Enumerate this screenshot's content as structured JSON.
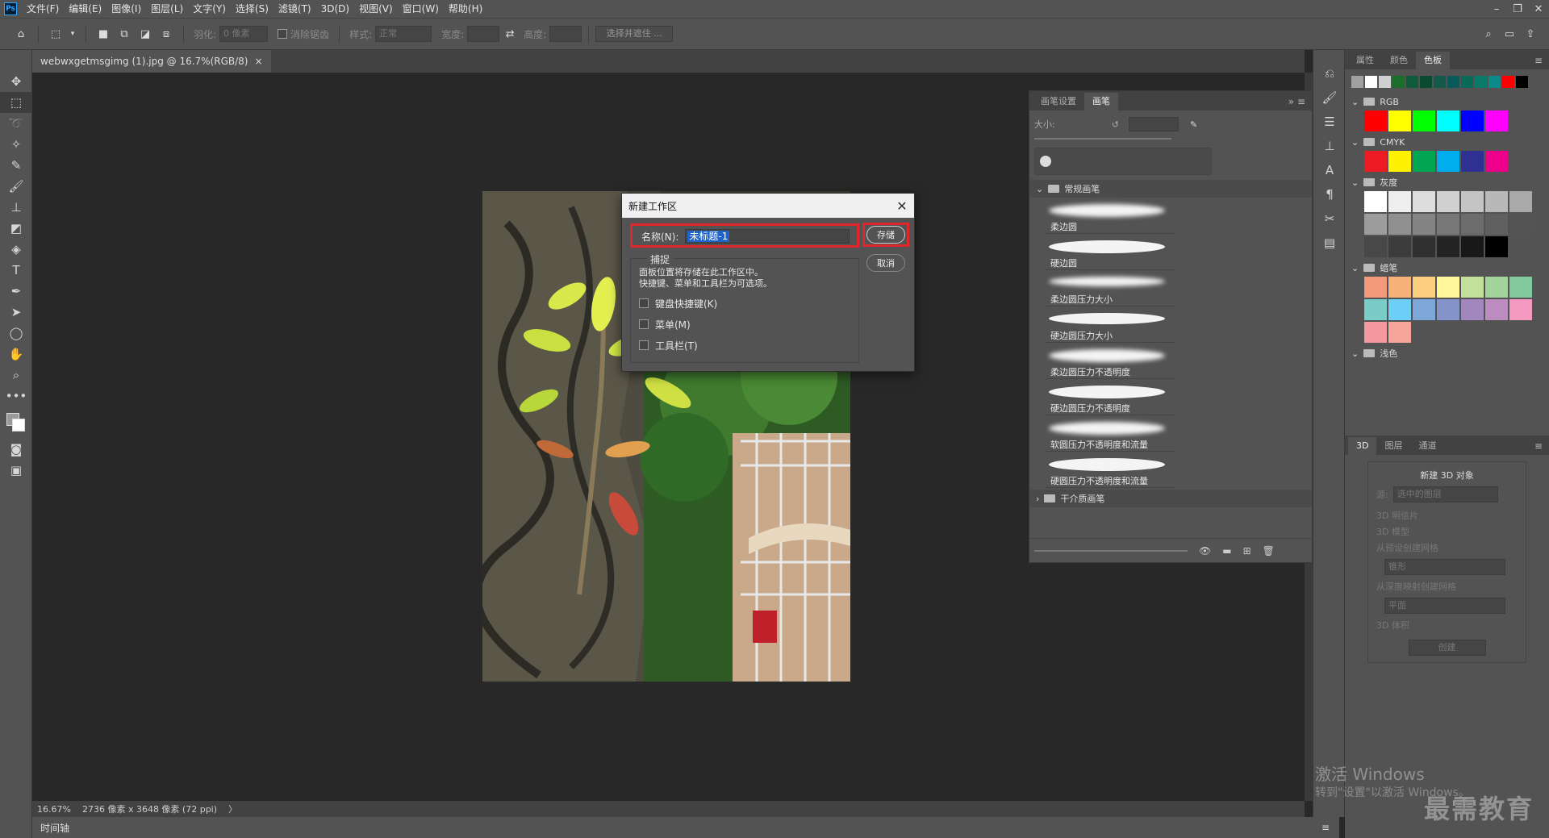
{
  "menubar": {
    "logo": "Ps",
    "items": [
      "文件(F)",
      "编辑(E)",
      "图像(I)",
      "图层(L)",
      "文字(Y)",
      "选择(S)",
      "滤镜(T)",
      "3D(D)",
      "视图(V)",
      "窗口(W)",
      "帮助(H)"
    ]
  },
  "options": {
    "feather_label": "羽化:",
    "feather_value": "0 像素",
    "antialias_label": "消除锯齿",
    "style_label": "样式:",
    "style_value": "正常",
    "width_label": "宽度:",
    "height_label": "高度:",
    "select_mask_button": "选择并遮住 ..."
  },
  "document": {
    "tab_title": "webwxgetmsgimg (1).jpg @ 16.7%(RGB/8)",
    "close": "×"
  },
  "status": {
    "zoom": "16.67%",
    "info": "2736 像素 x 3648 像素 (72 ppi)",
    "arrow": "〉"
  },
  "timeline": {
    "label": "时间轴"
  },
  "dialog": {
    "title": "新建工作区",
    "name_label": "名称(N):",
    "name_value": "未标题-1",
    "capture_label": "捕捉",
    "description_line1": "面板位置将存储在此工作区中。",
    "description_line2": "快捷键、菜单和工具栏为可选项。",
    "checkbox_shortcuts": "键盘快捷键(K)",
    "checkbox_menus": "菜单(M)",
    "checkbox_toolbar": "工具栏(T)",
    "save_button": "存储",
    "cancel_button": "取消"
  },
  "brush_panel": {
    "tabs": [
      "画笔设置",
      "画笔"
    ],
    "size_label": "大小:",
    "group_general": "常规画笔",
    "brushes": [
      "柔边圆",
      "硬边圆",
      "柔边圆压力大小",
      "硬边圆压力大小",
      "柔边圆压力不透明度",
      "硬边圆压力不透明度",
      "软圆压力不透明度和流量",
      "硬圆压力不透明度和流量"
    ],
    "group_dry": "干介质画笔"
  },
  "swatches_panel": {
    "tabs": [
      "属性",
      "颜色",
      "色板"
    ],
    "recent": [
      "#a0a0a0",
      "#ffffff",
      "#d0d0d0",
      "#1a6e2a",
      "#0e5a3a",
      "#0a4a30",
      "#145a4a",
      "#0a5a5a",
      "#0a6a5a",
      "#0a7a6a",
      "#0a8a8a",
      "#ff0000",
      "#000000"
    ],
    "groups": [
      {
        "name": "RGB",
        "colors": [
          "#ff0000",
          "#ffff00",
          "#00ff00",
          "#00ffff",
          "#0000ff",
          "#ff00ff"
        ]
      },
      {
        "name": "CMYK",
        "colors": [
          "#ed1c24",
          "#fff200",
          "#00a651",
          "#00aeef",
          "#2e3192",
          "#ec008c"
        ]
      },
      {
        "name": "灰度",
        "colors": [
          "#ffffff",
          "#eeeeee",
          "#dddddd",
          "#d0d0d0",
          "#c4c4c4",
          "#b8b8b8",
          "#aaaaaa",
          "#9c9c9c",
          "#909090",
          "#848484",
          "#787878",
          "#6c6c6c",
          "#606060",
          "#545454",
          "#484848",
          "#3c3c3c",
          "#303030",
          "#242424",
          "#181818",
          "#000000"
        ]
      },
      {
        "name": "蜡笔",
        "colors": [
          "#f49a7a",
          "#f7b27a",
          "#fbcf7e",
          "#fff799",
          "#c4df9b",
          "#a3d39c",
          "#82ca9d",
          "#7accc8",
          "#6dcff6",
          "#7da7d9",
          "#8493ca",
          "#a187be",
          "#bd8cbf",
          "#f49ac1",
          "#f5989d",
          "#f7a59b"
        ]
      },
      {
        "name": "浅色",
        "colors": []
      }
    ]
  },
  "threed_panel": {
    "tabs": [
      "3D",
      "图层",
      "通道"
    ],
    "title": "新建 3D 对象",
    "source_label": "源:",
    "source_value": "选中的图层",
    "options": [
      "3D 明信片",
      "3D 模型",
      "从预设创建网格",
      "从深度映射创建网格",
      "3D 体积"
    ],
    "preset_value": "锥形",
    "depth_value": "平面",
    "create_button": "创建"
  },
  "watermark": {
    "line1": "激活 Windows",
    "line2": "转到\"设置\"以激活 Windows。",
    "brand": "最需教育"
  },
  "icons": {
    "tools": [
      "move-icon",
      "marquee-icon",
      "lasso-icon",
      "magic-wand-icon",
      "eyedropper-icon",
      "brush-icon",
      "stamp-icon",
      "eraser-icon",
      "paint-bucket-icon",
      "type-icon",
      "pen-icon",
      "path-select-icon",
      "ellipse-icon",
      "hand-icon",
      "zoom-icon",
      "more-icon"
    ]
  }
}
